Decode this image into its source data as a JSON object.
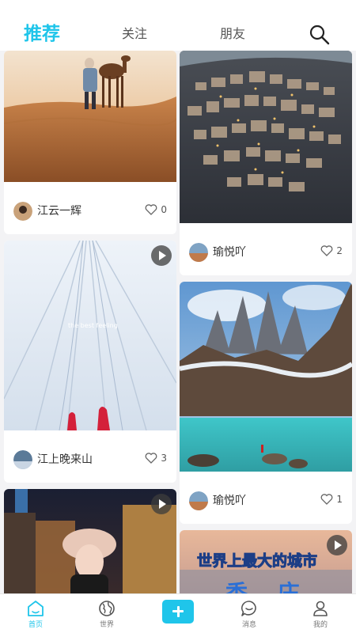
{
  "top_tabs": [
    {
      "label": "推荐",
      "active": true
    },
    {
      "label": "关注",
      "active": false
    },
    {
      "label": "朋友",
      "active": false
    }
  ],
  "search": {
    "icon": "search-icon"
  },
  "feed": {
    "left": [
      {
        "image": "desert-camel",
        "user": "江云一辉",
        "likes": "0",
        "video": false
      },
      {
        "image": "snow-ski-tracks",
        "user": "江上晚来山",
        "likes": "3",
        "video": true,
        "overlay_text": "the best feeling"
      },
      {
        "image": "night-street-portrait",
        "user": "",
        "likes": "",
        "video": true
      }
    ],
    "right": [
      {
        "image": "hillside-town-night",
        "user": "瑜悦吖",
        "likes": "2",
        "video": false
      },
      {
        "image": "mountain-lake",
        "user": "瑜悦吖",
        "likes": "1",
        "video": false
      },
      {
        "image": "city-title-card",
        "user": "",
        "likes": "",
        "video": true,
        "caption": "世界上最大的城市",
        "caption_partial": "香 庄"
      }
    ]
  },
  "bottom_nav": [
    {
      "label": "首页",
      "icon": "home-icon",
      "active": true
    },
    {
      "label": "世界",
      "icon": "globe-icon",
      "active": false
    },
    {
      "label": "",
      "icon": "plus-icon",
      "active": false
    },
    {
      "label": "消息",
      "icon": "chat-icon",
      "active": false
    },
    {
      "label": "我的",
      "icon": "user-icon",
      "active": false
    }
  ],
  "colors": {
    "accent": "#1fc5ea",
    "background": "#f3f3f5",
    "card": "#ffffff"
  }
}
